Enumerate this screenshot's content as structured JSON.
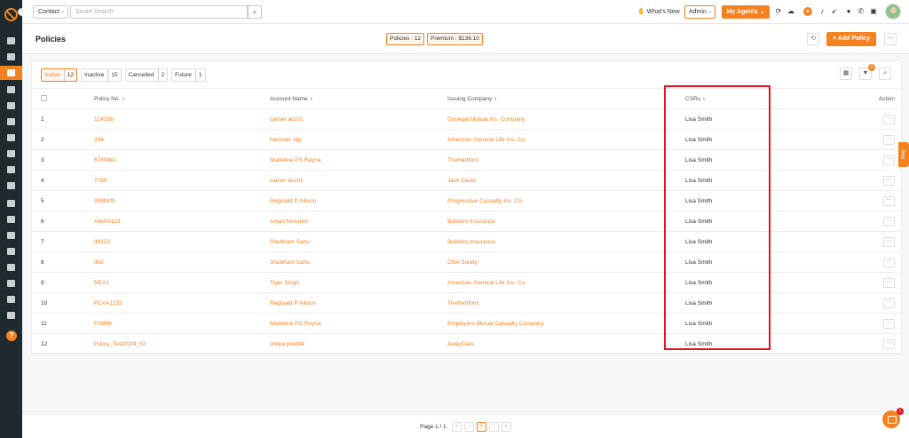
{
  "topbar": {
    "contact_select": "Contact",
    "search_placeholder": "Smart Search",
    "whats_new": "What's New",
    "role_select": "Admin",
    "my_agents": "My Agents"
  },
  "header": {
    "title": "Policies",
    "policies_pill": "Policies : 12",
    "premium_pill": "Premium : $136.10",
    "add_policy": "Add Policy"
  },
  "status_tabs": [
    {
      "label": "Active",
      "count": "12"
    },
    {
      "label": "Inactive",
      "count": "15"
    },
    {
      "label": "Cancelled",
      "count": "2"
    },
    {
      "label": "Future",
      "count": "1"
    }
  ],
  "filter_badge": "0",
  "table": {
    "headers": [
      "Policy No.",
      "Account Name",
      "Issuing Company",
      "CSRs",
      "Action"
    ],
    "rows": [
      {
        "num": "1",
        "policy": "124356",
        "account": "carrier acc01",
        "company": "Donegal Mutual Ins. Company",
        "csr": "Lisa Smith"
      },
      {
        "num": "2",
        "policy": "234",
        "account": "hammer clip",
        "company": "American General Life Ins. Co.",
        "csr": "Lisa Smith"
      },
      {
        "num": "3",
        "policy": "6789WA",
        "account": "Madeline PS Reyna",
        "company": "TheHartford",
        "csr": "Lisa Smith"
      },
      {
        "num": "4",
        "policy": "7789",
        "account": "carrier acc01",
        "company": "Jack David",
        "csr": "Lisa Smith"
      },
      {
        "num": "5",
        "policy": "998htrfh",
        "account": "Reginald P Allison",
        "company": "Progressive Casualty Ins. Co.",
        "csr": "Lisa Smith"
      },
      {
        "num": "6",
        "policy": "AMAN123",
        "account": "Aman Nexsure",
        "company": "Builders Insurance",
        "csr": "Lisa Smith"
      },
      {
        "num": "7",
        "policy": "IM123",
        "account": "Shubham Sahu",
        "company": "Builders Insurance",
        "csr": "Lisa Smith"
      },
      {
        "num": "8",
        "policy": "IM2",
        "account": "Shubham Sahu",
        "company": "CNA Surety",
        "csr": "Lisa Smith"
      },
      {
        "num": "9",
        "policy": "NEX1",
        "account": "Tiger Singh",
        "company": "American General Life Ins. Co.",
        "csr": "Lisa Smith"
      },
      {
        "num": "10",
        "policy": "PCVA1233",
        "account": "Reginald P Allison",
        "company": "TheHartford",
        "csr": "Lisa Smith"
      },
      {
        "num": "11",
        "policy": "PS986",
        "account": "Madeline PS Reyna",
        "company": "Employers Mutual Casualty Company",
        "csr": "Lisa Smith"
      },
      {
        "num": "12",
        "policy": "Policy_Test2024_02",
        "account": "shilpa prod04",
        "company": "AwayCare",
        "csr": "Lisa Smith"
      }
    ]
  },
  "pager": {
    "label": "Page 1 / 1",
    "current": "1"
  },
  "help_tab": "Help",
  "chat_badge": "1",
  "colors": {
    "accent": "#f58220",
    "sidebar": "#1e2a2e",
    "highlight": "#e0141e"
  }
}
